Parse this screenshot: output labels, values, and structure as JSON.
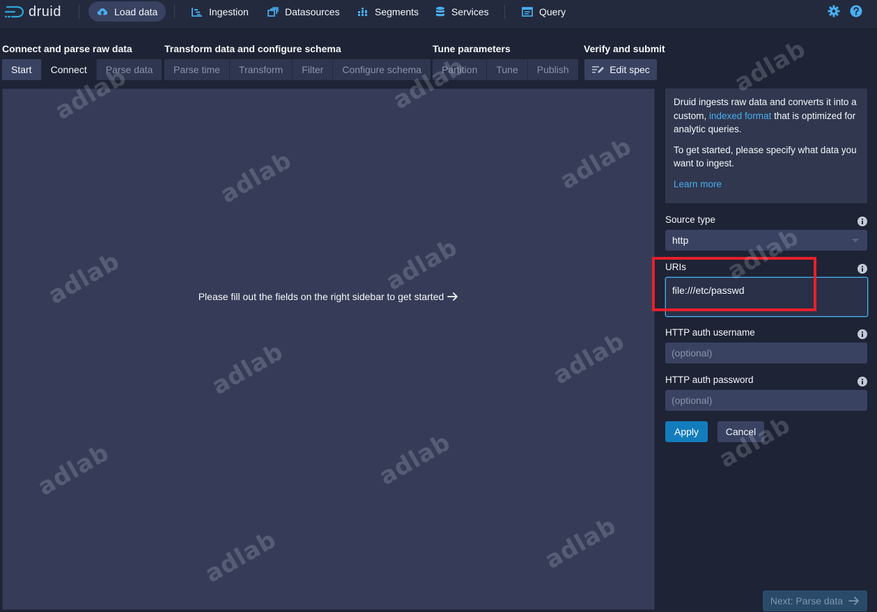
{
  "header": {
    "app_name": "druid",
    "nav": [
      {
        "label": "Load data",
        "icon": "cloud-upload-icon",
        "active": true
      },
      {
        "label": "Ingestion",
        "icon": "gantt-chart-icon"
      },
      {
        "label": "Datasources",
        "icon": "multi-select-icon"
      },
      {
        "label": "Segments",
        "icon": "stacked-bars-icon"
      },
      {
        "label": "Services",
        "icon": "database-icon"
      },
      {
        "label": "Query",
        "icon": "application-icon"
      }
    ],
    "right_icons": [
      "settings-gear-icon",
      "help-icon"
    ]
  },
  "steps": {
    "groups": [
      {
        "title": "Connect and parse raw data",
        "steps": [
          "Start",
          "Connect",
          "Parse data"
        ]
      },
      {
        "title": "Transform data and configure schema",
        "steps": [
          "Parse time",
          "Transform",
          "Filter",
          "Configure schema"
        ]
      },
      {
        "title": "Tune parameters",
        "steps": [
          "Partition",
          "Tune",
          "Publish"
        ]
      },
      {
        "title": "Verify and submit",
        "steps": [
          "Edit spec"
        ]
      }
    ],
    "current_step": "Connect"
  },
  "main": {
    "message": "Please fill out the fields on the right sidebar to get started"
  },
  "sidebar": {
    "info": {
      "text_before_link": "Druid ingests raw data and converts it into a custom, ",
      "link_text": "indexed format",
      "text_after_link": " that is optimized for analytic queries.",
      "paragraph2": "To get started, please specify what data you want to ingest.",
      "learn_more": "Learn more"
    },
    "source_type": {
      "label": "Source type",
      "value": "http"
    },
    "uris": {
      "label": "URIs",
      "value": "file:///etc/passwd"
    },
    "http_auth_username": {
      "label": "HTTP auth username",
      "placeholder": "(optional)"
    },
    "http_auth_password": {
      "label": "HTTP auth password",
      "placeholder": "(optional)"
    },
    "apply_label": "Apply",
    "cancel_label": "Cancel"
  },
  "footer": {
    "next_label": "Next: Parse data"
  },
  "watermark": "adlab",
  "colors": {
    "background": "#1e2335",
    "panel": "#363c57",
    "accent_blue": "#137cbd",
    "link_blue": "#48aff0",
    "highlight_red": "#e8202a"
  }
}
